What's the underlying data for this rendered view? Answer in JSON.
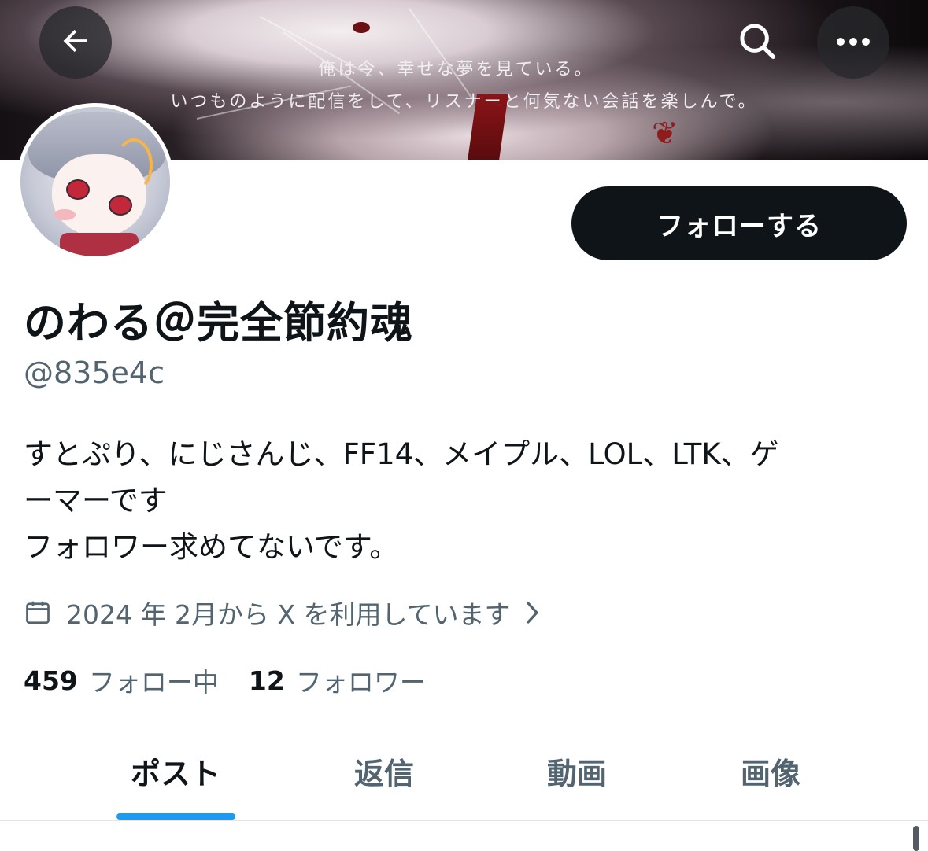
{
  "header": {
    "banner_caption_line1": "俺は今、幸せな夢を見ている。",
    "banner_caption_line2": "いつものように配信をして、リスナーと何気ない会話を楽しんで。",
    "back_icon": "arrow-left-icon",
    "search_icon": "search-icon",
    "more_icon": "more-horizontal-icon"
  },
  "profile": {
    "display_name": "のわる＠完全節約魂",
    "handle": "@835e4c",
    "follow_label": "フォローする",
    "bio_lines": [
      "すとぷり、にじさんじ、FF14、メイプル、LOL、LTK、ゲ",
      "ーマーです",
      "フォロワー求めてないです。"
    ],
    "joined_text": "2024 年 2月から X を利用しています",
    "joined_icon": "calendar-icon",
    "following_count": "459",
    "following_label": "フォロー中",
    "followers_count": "12",
    "followers_label": "フォロワー"
  },
  "tabs": [
    {
      "label": "ポスト",
      "active": true
    },
    {
      "label": "返信",
      "active": false
    },
    {
      "label": "動画",
      "active": false
    },
    {
      "label": "画像",
      "active": false
    }
  ],
  "colors": {
    "accent": "#1d9bf0",
    "text_primary": "#0f1419",
    "text_secondary": "#536471",
    "button_bg": "#0f1419"
  }
}
